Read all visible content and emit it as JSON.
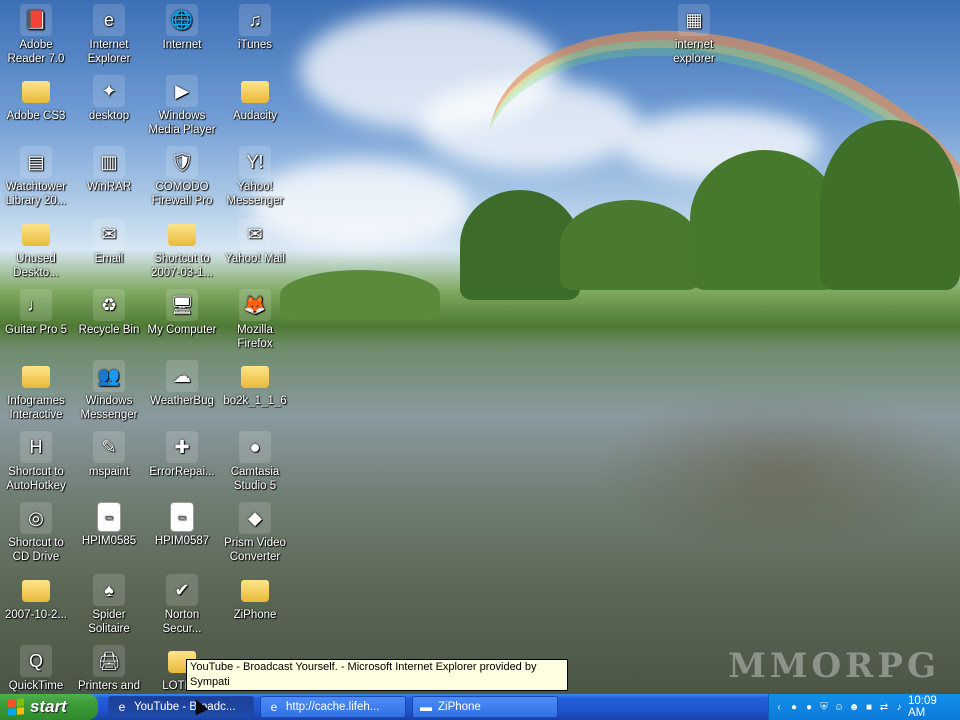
{
  "desktop": {
    "icons": [
      {
        "label": "Adobe Reader 7.0",
        "icon": "adobe-reader-icon",
        "glyph": "📕"
      },
      {
        "label": "Internet Explorer",
        "icon": "internet-explorer-icon",
        "glyph": "e"
      },
      {
        "label": "Internet",
        "icon": "internet-globe-icon",
        "glyph": "🌐"
      },
      {
        "label": "iTunes",
        "icon": "itunes-icon",
        "glyph": "♫"
      },
      {
        "label": "internet explorer",
        "icon": "ie-shortcut-icon",
        "glyph": "▦"
      },
      {
        "label": "Adobe CS3",
        "icon": "folder-icon",
        "glyph": ""
      },
      {
        "label": "desktop",
        "icon": "desktop-shortcut-icon",
        "glyph": "✦"
      },
      {
        "label": "Windows Media Player",
        "icon": "media-player-icon",
        "glyph": "▶"
      },
      {
        "label": "Audacity",
        "icon": "folder-icon",
        "glyph": ""
      },
      {
        "label": "Watchtower Library 20...",
        "icon": "watchtower-icon",
        "glyph": "▤"
      },
      {
        "label": "WinRAR",
        "icon": "winrar-icon",
        "glyph": "▥"
      },
      {
        "label": "COMODO Firewall Pro",
        "icon": "comodo-shield-icon",
        "glyph": "🛡"
      },
      {
        "label": "Yahoo! Messenger",
        "icon": "yahoo-messenger-icon",
        "glyph": "Y!"
      },
      {
        "label": "Unused Deskto...",
        "icon": "folder-icon",
        "glyph": ""
      },
      {
        "label": "Email",
        "icon": "email-icon",
        "glyph": "✉"
      },
      {
        "label": "Shortcut to 2007-03-1...",
        "icon": "folder-icon",
        "glyph": ""
      },
      {
        "label": "Yahoo! Mail",
        "icon": "yahoo-mail-icon",
        "glyph": "✉"
      },
      {
        "label": "Guitar Pro 5",
        "icon": "guitar-pro-icon",
        "glyph": "♩"
      },
      {
        "label": "Recycle Bin",
        "icon": "recycle-bin-icon",
        "glyph": "♻"
      },
      {
        "label": "My Computer",
        "icon": "my-computer-icon",
        "glyph": "🖥"
      },
      {
        "label": "Mozilla Firefox",
        "icon": "firefox-icon",
        "glyph": "🦊"
      },
      {
        "label": "Infogrames Interactive",
        "icon": "folder-icon",
        "glyph": ""
      },
      {
        "label": "Windows Messenger",
        "icon": "windows-messenger-icon",
        "glyph": "👥"
      },
      {
        "label": "WeatherBug",
        "icon": "weatherbug-icon",
        "glyph": "☁"
      },
      {
        "label": "bo2k_1_1_6",
        "icon": "folder-icon",
        "glyph": ""
      },
      {
        "label": "Shortcut to AutoHotkey",
        "icon": "autohotkey-icon",
        "glyph": "H"
      },
      {
        "label": "mspaint",
        "icon": "mspaint-icon",
        "glyph": "✎"
      },
      {
        "label": "ErrorRepai...",
        "icon": "error-repair-icon",
        "glyph": "✚"
      },
      {
        "label": "Camtasia Studio 5",
        "icon": "camtasia-icon",
        "glyph": "●"
      },
      {
        "label": "Shortcut to CD Drive",
        "icon": "cd-drive-icon",
        "glyph": "◎"
      },
      {
        "label": "HPIM0585",
        "icon": "document-icon",
        "glyph": "▭"
      },
      {
        "label": "HPIM0587",
        "icon": "document-icon",
        "glyph": "▭"
      },
      {
        "label": "Prism Video Converter",
        "icon": "prism-icon",
        "glyph": "◆"
      },
      {
        "label": "2007-10-2...",
        "icon": "folder-icon",
        "glyph": ""
      },
      {
        "label": "Spider Solitaire",
        "icon": "spider-solitaire-icon",
        "glyph": "♠"
      },
      {
        "label": "Norton Secur...",
        "icon": "norton-icon",
        "glyph": "✔"
      },
      {
        "label": "ZiPhone",
        "icon": "folder-icon",
        "glyph": ""
      },
      {
        "label": "QuickTime",
        "icon": "quicktime-icon",
        "glyph": "Q"
      },
      {
        "label": "Printers and",
        "icon": "printers-icon",
        "glyph": "🖨"
      },
      {
        "label": "LOTRO",
        "icon": "folder-icon",
        "glyph": ""
      }
    ],
    "watermark": "MMORPG"
  },
  "tooltip": {
    "text": "YouTube - Broadcast Yourself. - Microsoft Internet Explorer provided by Sympati"
  },
  "taskbar": {
    "start_label": "start",
    "buttons": [
      {
        "label": "YouTube - Broadc...",
        "icon": "ie-icon",
        "glyph": "e",
        "active": true
      },
      {
        "label": "http://cache.lifeh...",
        "icon": "ie-icon",
        "glyph": "e",
        "active": false
      },
      {
        "label": "ZiPhone",
        "icon": "folder-icon",
        "glyph": "▬",
        "active": false
      }
    ],
    "tray_icons": [
      {
        "icon": "back-arrow-icon",
        "glyph": "‹"
      },
      {
        "icon": "green-status-icon",
        "glyph": "●"
      },
      {
        "icon": "green-orb-icon",
        "glyph": "●"
      },
      {
        "icon": "shield-icon",
        "glyph": "⛨"
      },
      {
        "icon": "messenger-icon",
        "glyph": "☺"
      },
      {
        "icon": "yahoo-smiley-icon",
        "glyph": "☻"
      },
      {
        "icon": "camtasia-tray-icon",
        "glyph": "■"
      },
      {
        "icon": "network-icon",
        "glyph": "⇄"
      },
      {
        "icon": "volume-icon",
        "glyph": "♪"
      }
    ],
    "clock": "10:09 AM"
  }
}
